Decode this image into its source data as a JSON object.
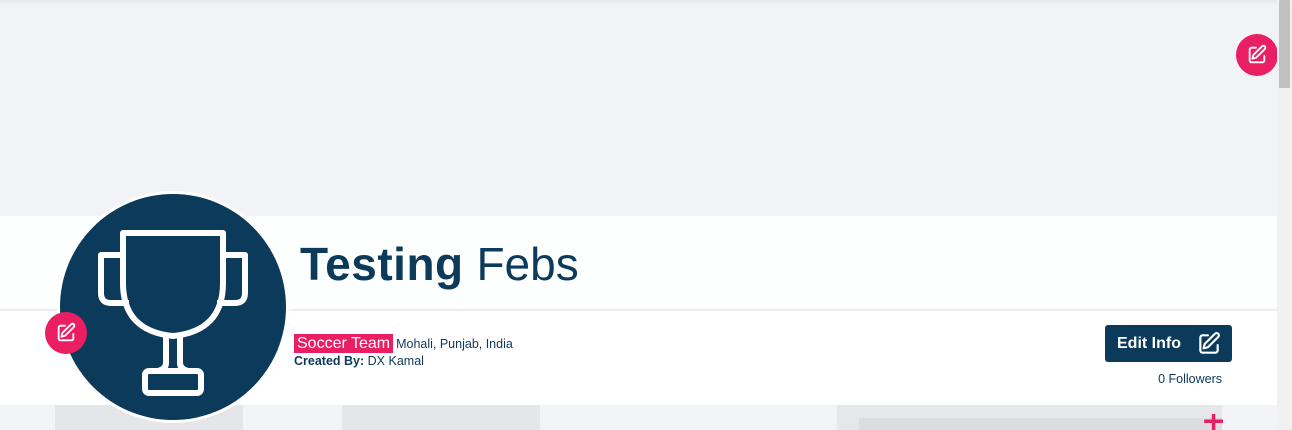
{
  "profile": {
    "name_first": "Testing",
    "name_last": "Febs",
    "sport": "Soccer Team",
    "location": "Mohali, Punjab, India",
    "created_by_label": "Created By:",
    "created_by_name": "DX Kamal",
    "followers": "0 Followers"
  },
  "actions": {
    "edit_info_label": "Edit Info"
  },
  "icons": {
    "cover_edit": "edit-square-icon",
    "avatar_edit": "edit-square-icon",
    "avatar": "trophy-icon",
    "add": "plus-icon"
  },
  "colors": {
    "brand_navy": "#0c3a5b",
    "accent_pink": "#ea1e63",
    "cover_bg": "#f2f3f7"
  }
}
